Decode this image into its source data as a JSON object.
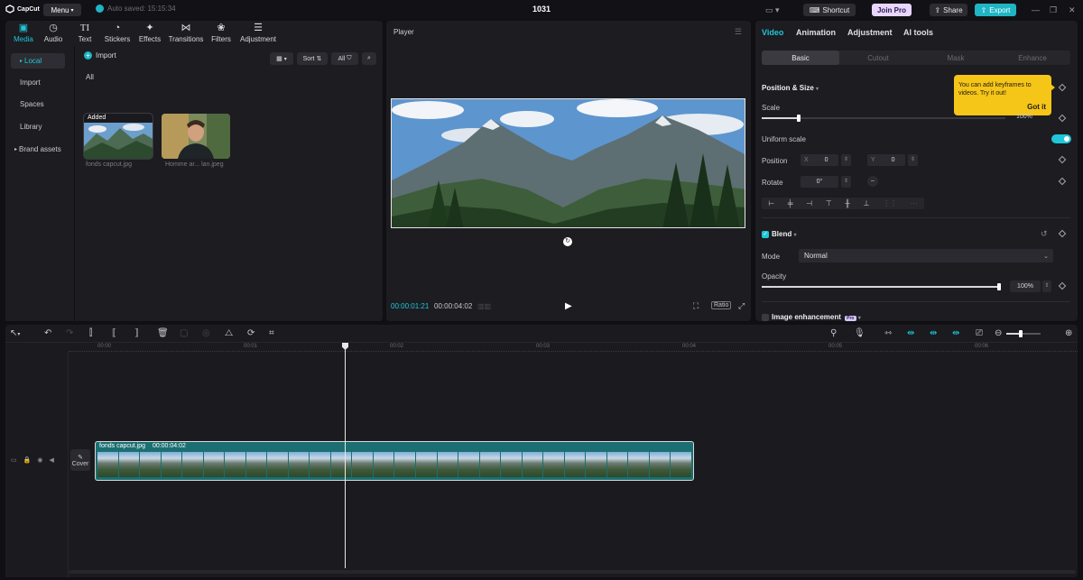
{
  "titlebar": {
    "logo": "CapCut",
    "menu_label": "Menu",
    "autosave": "Auto saved: 15:15:34",
    "project_title": "1031",
    "shortcut_label": "Shortcut",
    "joinpro_label": "Join Pro",
    "share_label": "Share",
    "export_label": "Export"
  },
  "media": {
    "tools": [
      {
        "label": "Media",
        "icon": "media-icon"
      },
      {
        "label": "Audio",
        "icon": "audio-icon"
      },
      {
        "label": "Text",
        "icon": "text-icon"
      },
      {
        "label": "Stickers",
        "icon": "stickers-icon"
      },
      {
        "label": "Effects",
        "icon": "effects-icon"
      },
      {
        "label": "Transitions",
        "icon": "transitions-icon"
      },
      {
        "label": "Filters",
        "icon": "filters-icon"
      },
      {
        "label": "Adjustment",
        "icon": "adjustment-icon"
      }
    ],
    "sidebar": [
      "Local",
      "Import",
      "Spaces",
      "Library",
      "Brand assets"
    ],
    "import_label": "Import",
    "sort_label": "Sort",
    "all_chip": "All",
    "section_label": "All",
    "added_badge": "Added",
    "files": [
      "fonds capcut.jpg",
      "Homme ar... lan.jpeg"
    ]
  },
  "player": {
    "title": "Player",
    "current_time": "00:00:01:21",
    "total_time": "00:00:04:02",
    "ratio_label": "Ratio"
  },
  "props": {
    "tabs": [
      "Video",
      "Animation",
      "Adjustment",
      "AI tools"
    ],
    "subtabs": [
      "Basic",
      "Cutout",
      "Mask",
      "Enhance"
    ],
    "position_size_title": "Position & Size",
    "tooltip_text": "You can add keyframes to videos. Try it out!",
    "tooltip_button": "Got it",
    "scale_label": "Scale",
    "scale_value": "100%",
    "scale_level": 0.15,
    "uniform_scale_label": "Uniform scale",
    "position_label": "Position",
    "x_label": "X",
    "x_value": "0",
    "y_label": "Y",
    "y_value": "0",
    "rotate_label": "Rotate",
    "rotate_value": "0°",
    "blend_title": "Blend",
    "mode_label": "Mode",
    "mode_value": "Normal",
    "opacity_label": "Opacity",
    "opacity_value": "100%",
    "opacity_level": 1.0,
    "image_enhancement_title": "Image enhancement",
    "pro_badge": "Pro"
  },
  "timeline": {
    "ruler_labels": [
      "00:00",
      "00:01",
      "00:02",
      "00:03",
      "00:04",
      "00:05",
      "00:06"
    ],
    "clip_name": "fonds capcut.jpg",
    "clip_duration": "00:00:04:02",
    "cover_label": "Cover"
  },
  "colors": {
    "accent": "#1fc7d8",
    "join_pro_bg": "#e9d6ff",
    "export_bg": "#1fb5c5",
    "tooltip_bg": "#f5c518",
    "clip_bg": "#1b6f72"
  }
}
